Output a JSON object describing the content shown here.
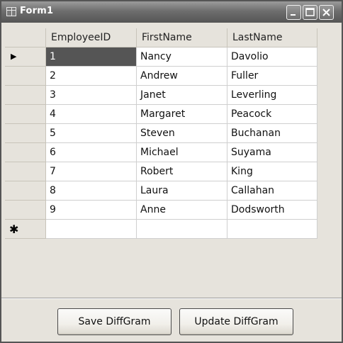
{
  "window": {
    "title": "Form1",
    "icons": [
      "app-icon",
      "minimize-icon",
      "maximize-icon",
      "close-icon"
    ]
  },
  "grid": {
    "columns": [
      "EmployeeID",
      "FirstName",
      "LastName"
    ],
    "rows": [
      [
        "1",
        "Nancy",
        "Davolio"
      ],
      [
        "2",
        "Andrew",
        "Fuller"
      ],
      [
        "3",
        "Janet",
        "Leverling"
      ],
      [
        "4",
        "Margaret",
        "Peacock"
      ],
      [
        "5",
        "Steven",
        "Buchanan"
      ],
      [
        "6",
        "Michael",
        "Suyama"
      ],
      [
        "7",
        "Robert",
        "King"
      ],
      [
        "8",
        "Laura",
        "Callahan"
      ],
      [
        "9",
        "Anne",
        "Dodsworth"
      ]
    ],
    "current_row_marker": "▶",
    "new_row_marker": "✱"
  },
  "buttons": {
    "save_label": "Save DiffGram",
    "update_label": "Update DiffGram"
  },
  "colors": {
    "titlebar": "#6e6e6e",
    "form_background": "#e6e3dc",
    "selected_cell": "#555555"
  }
}
